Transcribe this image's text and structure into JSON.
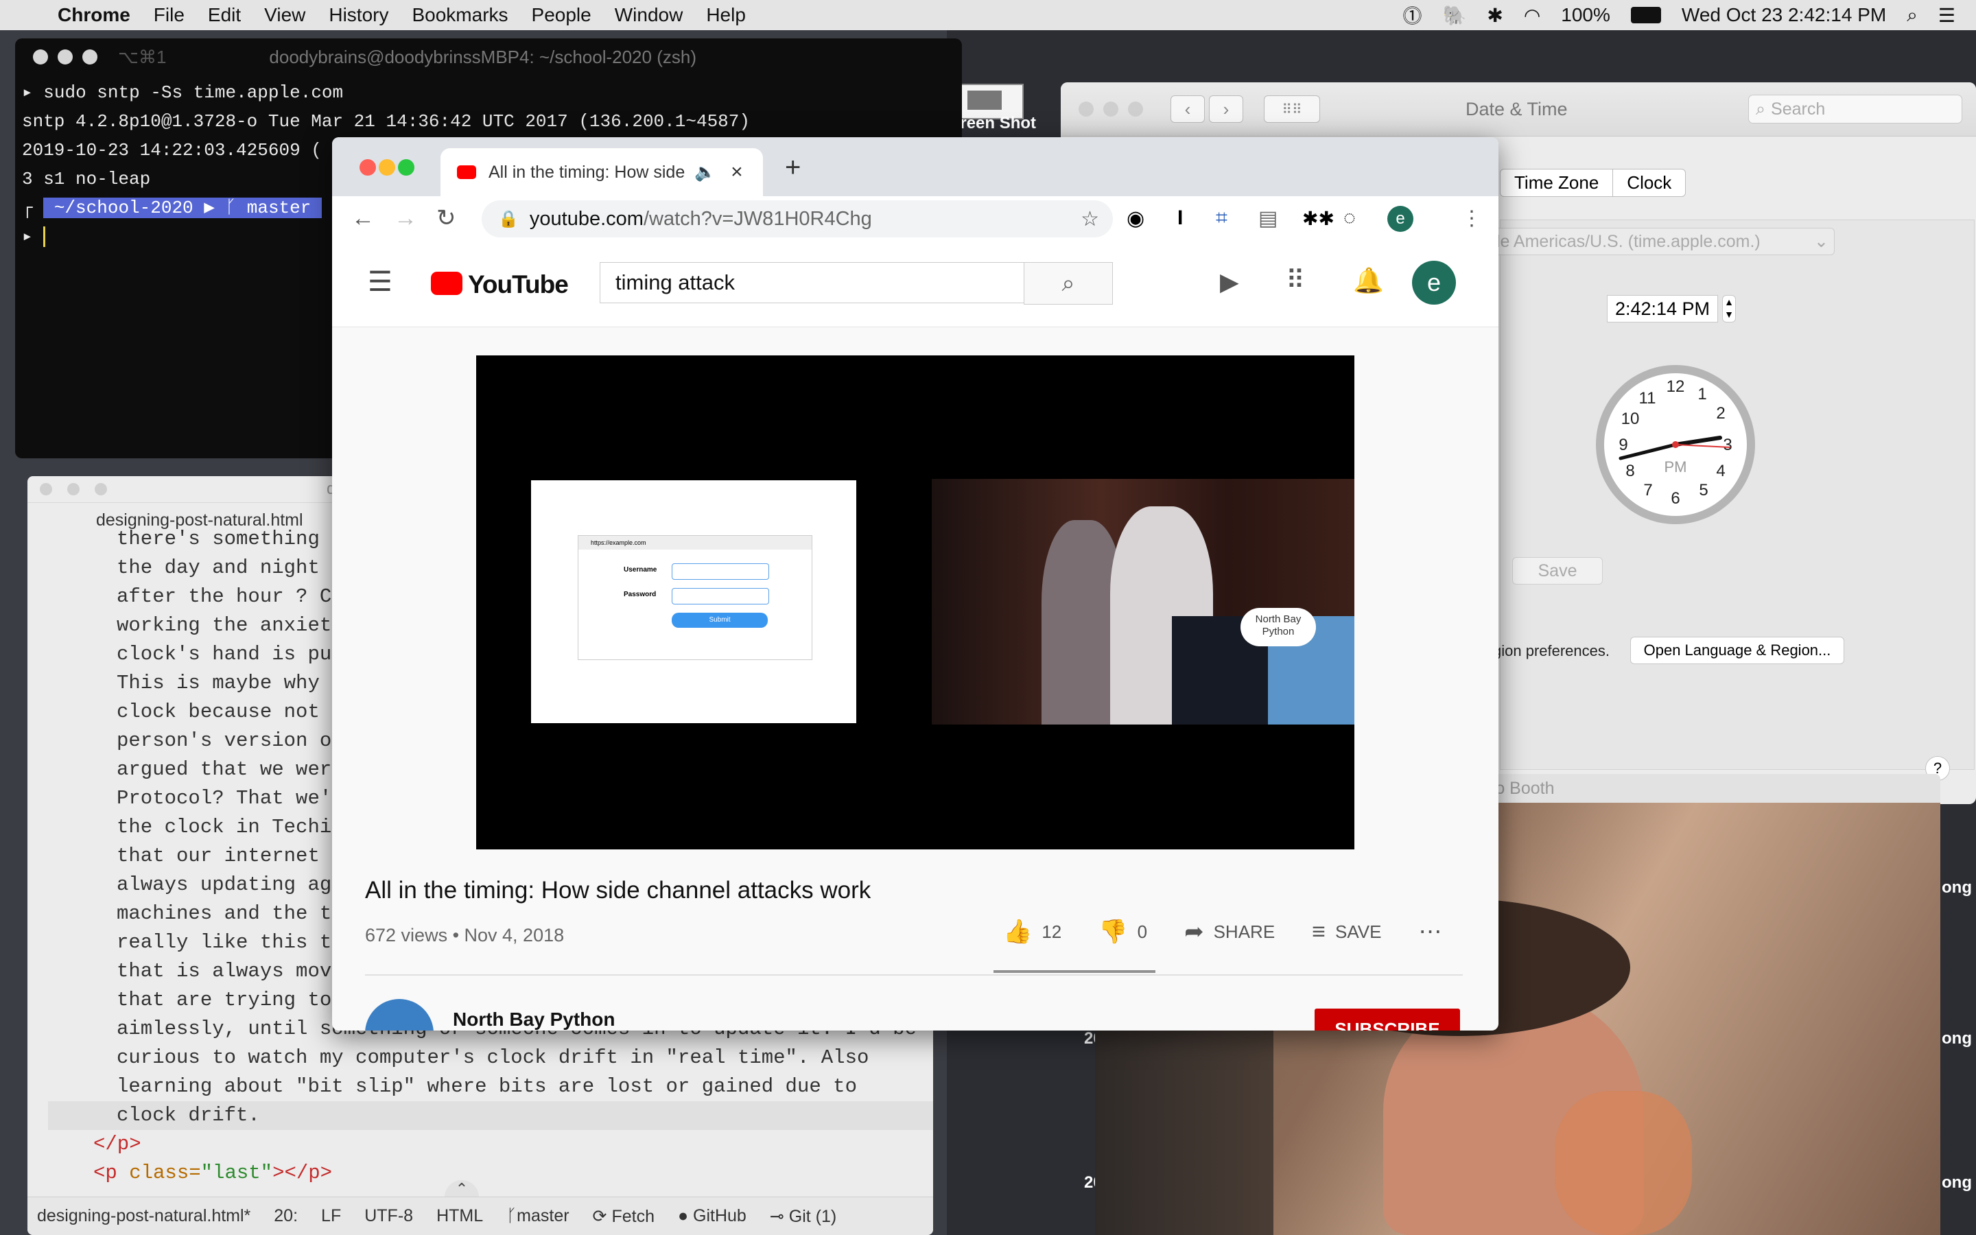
{
  "menubar": {
    "app": "Chrome",
    "items": [
      "File",
      "Edit",
      "View",
      "History",
      "Bookmarks",
      "People",
      "Window",
      "Help"
    ],
    "battery": "100%",
    "clock": "Wed Oct 23  2:42:14 PM"
  },
  "desktop": {
    "screenshot_label": "Screen Shot",
    "year_labels": [
      "2019",
      "2019"
    ],
    "suffix_labels": [
      "ong",
      "ong",
      "ong"
    ]
  },
  "terminal": {
    "shortcut": "⌥⌘1",
    "title": "doodybrains@doodybrinssMBP4: ~/school-2020 (zsh)",
    "lines": [
      "▸ sudo sntp -Ss time.apple.com",
      "sntp 4.2.8p10@1.3728-o Tue Mar 21 14:36:42 UTC 2017 (136.200.1~4587)",
      "2019-10-23 14:22:03.425609 (",
      "3 s1 no-leap"
    ],
    "prompt_dir": "~/school-2020",
    "prompt_branch": "master"
  },
  "editor": {
    "title": "design",
    "tab": "designing-post-natural.html",
    "lines": [
      "there's something",
      "the day and night f",
      "after the hour ? Cl",
      "working the anxiety",
      "clock's hand is pul",
      "This is maybe why i",
      "clock because not c",
      "person's version of",
      "argued that we were",
      "Protocol? That we'r",
      "the clock in Techir",
      "that our internet r",
      "always updating aga",
      "machines and the th",
      "really like this te",
      "that is always movi",
      "that are trying to",
      "aimlessly, until something or someone comes in to update it. I'd be",
      "curious to watch my computer's clock drift in \"real time\". Also",
      "learning about \"bit slip\" where bits are lost or gained due to",
      "clock drift."
    ],
    "close_p": "</p>",
    "last_p_open": "<p",
    "last_p_attr": "class=",
    "last_p_val": "\"last\"",
    "last_p_close": "></p>",
    "status": {
      "file": "designing-post-natural.html*",
      "pos": "20:",
      "eol": "LF",
      "enc": "UTF-8",
      "grammar": "HTML",
      "branch": "master",
      "fetch": "Fetch",
      "github": "GitHub",
      "git": "Git (1)"
    }
  },
  "datetime": {
    "title": "Date & Time",
    "search_placeholder": "Search",
    "tabs": [
      "Time Zone",
      "Clock"
    ],
    "server": "ple Americas/U.S. (time.apple.com.)",
    "time": "2:42:14 PM",
    "clock_numbers": [
      "12",
      "1",
      "2",
      "3",
      "4",
      "5",
      "6",
      "7",
      "8",
      "9",
      "10",
      "11"
    ],
    "ampm": "PM",
    "save": "Save",
    "region_text": "gion preferences.",
    "open_region": "Open Language & Region...",
    "help": "?"
  },
  "photobooth": {
    "title": "oto Booth"
  },
  "chrome": {
    "tab_title": "All in the timing: How side c",
    "url_domain": "youtube.com",
    "url_path": "/watch?v=JW81H0R4Chg",
    "avatar": "e"
  },
  "youtube": {
    "logo": "YouTube",
    "search_value": "timing attack",
    "avatar": "e",
    "video_title": "All in the timing: How side channel attacks work",
    "views": "672 views • Nov 4, 2018",
    "likes": "12",
    "dislikes": "0",
    "share": "SHARE",
    "save": "SAVE",
    "channel": "North Bay Python",
    "subscribe": "SUBSCRIBE",
    "slide": {
      "url": "https://example.com",
      "username": "Username",
      "password": "Password",
      "submit": "Submit"
    },
    "podium_sign": "North Bay Python"
  }
}
